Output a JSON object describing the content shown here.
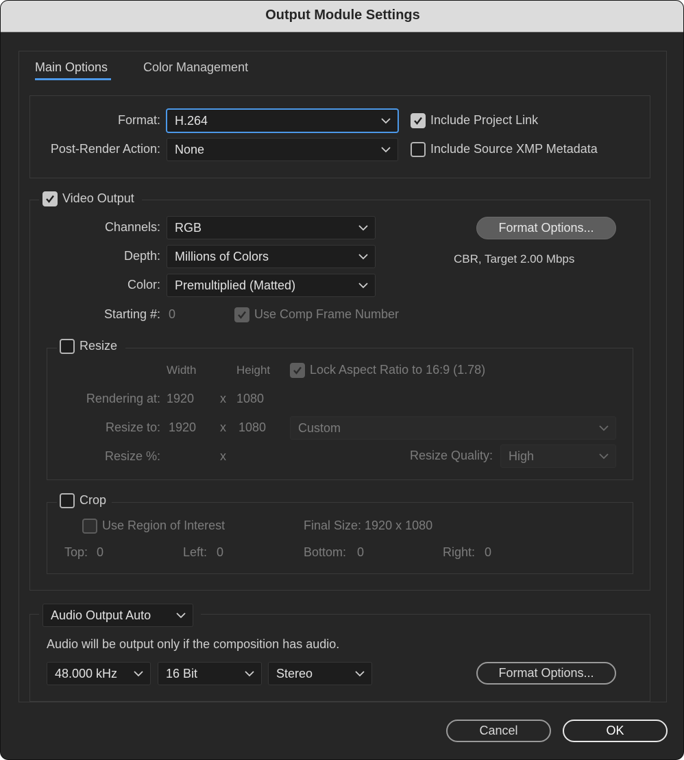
{
  "window": {
    "title": "Output Module Settings"
  },
  "tabs": [
    {
      "label": "Main Options",
      "active": true
    },
    {
      "label": "Color Management",
      "active": false
    }
  ],
  "format_group": {
    "format_label": "Format:",
    "format_value": "H.264",
    "post_render_label": "Post-Render Action:",
    "post_render_value": "None",
    "include_project_link": {
      "label": "Include Project Link",
      "checked": true
    },
    "include_xmp": {
      "label": "Include Source XMP Metadata",
      "checked": false
    }
  },
  "video_output": {
    "label": "Video Output",
    "checked": true,
    "channels_label": "Channels:",
    "channels_value": "RGB",
    "depth_label": "Depth:",
    "depth_value": "Millions of Colors",
    "color_label": "Color:",
    "color_value": "Premultiplied (Matted)",
    "starting_label": "Starting #:",
    "starting_value": "0",
    "use_comp_frame": {
      "label": "Use Comp Frame Number",
      "checked": true
    },
    "format_options_label": "Format Options...",
    "format_summary": "CBR, Target 2.00 Mbps"
  },
  "resize": {
    "label": "Resize",
    "checked": false,
    "width_header": "Width",
    "height_header": "Height",
    "lock_aspect": {
      "label": "Lock Aspect Ratio to 16:9 (1.78)",
      "checked": true
    },
    "rendering_at_label": "Rendering at:",
    "rendering_w": "1920",
    "rendering_h": "1080",
    "resize_to_label": "Resize to:",
    "resize_to_w": "1920",
    "resize_to_h": "1080",
    "preset_value": "Custom",
    "resize_pct_label": "Resize %:",
    "x_sep": "x",
    "quality_label": "Resize Quality:",
    "quality_value": "High"
  },
  "crop": {
    "label": "Crop",
    "checked": false,
    "use_roi": {
      "label": "Use Region of Interest",
      "checked": false
    },
    "final_size": "Final Size: 1920 x 1080",
    "top_label": "Top:",
    "top_value": "0",
    "left_label": "Left:",
    "left_value": "0",
    "bottom_label": "Bottom:",
    "bottom_value": "0",
    "right_label": "Right:",
    "right_value": "0"
  },
  "audio": {
    "mode_value": "Audio Output Auto",
    "note": "Audio will be output only if the composition has audio.",
    "rate_value": "48.000 kHz",
    "bits_value": "16 Bit",
    "channels_value": "Stereo",
    "format_options_label": "Format Options..."
  },
  "footer": {
    "cancel_label": "Cancel",
    "ok_label": "OK"
  },
  "colors": {
    "accent": "#4c98e8",
    "background": "#262626",
    "titlebar": "#dcdcdc"
  }
}
